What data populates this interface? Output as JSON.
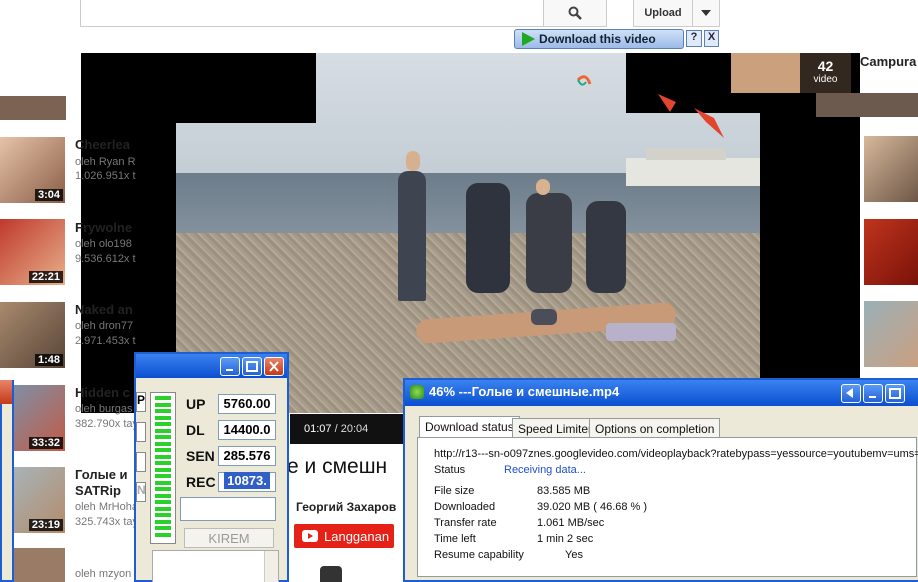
{
  "header": {
    "search_icon": "search-icon",
    "upload_label": "Upload",
    "upload_menu_icon": "chevron-down-icon",
    "download_button": "Download this video",
    "help_label": "?",
    "close_label": "X"
  },
  "player": {
    "time_current": "01:07",
    "time_sep": " / ",
    "time_total": "20:04",
    "title": "е и смешн",
    "channel": "Георгий Захаров",
    "subscribe_label": "Langganan"
  },
  "left_list": [
    {
      "title": "Cheerlea",
      "by": "oleh Ryan R",
      "views": "1.026.951x t",
      "duration": "3:04"
    },
    {
      "title": "Frywolne",
      "by": "oleh olo198",
      "views": "9.536.612x t",
      "duration": "22:21"
    },
    {
      "title": "Naked an",
      "by": "oleh dron77",
      "views": "2.971.453x t",
      "duration": "1:48"
    },
    {
      "title": "Hidden c",
      "by": "oleh burgas",
      "views": "382.790x tay",
      "duration": "33:32"
    },
    {
      "title": "Голые и",
      "title2": "SATRip",
      "by": "oleh MrHoha",
      "views": "325.743x tay",
      "duration": "23:19"
    },
    {
      "title": "",
      "by": "oleh mzyon",
      "views": "",
      "duration": ""
    }
  ],
  "right_list": {
    "playlist_count": "42",
    "playlist_unit": "video",
    "playlist_title": "Campura"
  },
  "meter_window": {
    "labels": {
      "up": "UP",
      "dl": "DL",
      "sen": "SEN",
      "rec": "REC"
    },
    "values": {
      "up": "5760.00",
      "dl": "14400.0",
      "sen": "285.576",
      "rec": "10873."
    },
    "kirem_label": "KIREM",
    "side_label_p": "P",
    "side_label_n": "N",
    "meter_level_fraction": 1.0
  },
  "download_window": {
    "title": "46% ---Голые и смешные.mp4",
    "tabs": [
      "Download status",
      "Speed Limiter",
      "Options on completion"
    ],
    "url": "http://r13---sn-o097znes.googlevideo.com/videoplayback?ratebypass=yessource=youtubemv=ums=",
    "status_label": "Status",
    "status_value": "Receiving data...",
    "rows": [
      {
        "label": "File size",
        "value": "83.585  MB"
      },
      {
        "label": "Downloaded",
        "value": "39.020  MB  ( 46.68 % )"
      },
      {
        "label": "Transfer rate",
        "value": "1.061  MB/sec"
      },
      {
        "label": "Time left",
        "value": "1 min 2 sec"
      },
      {
        "label": "Resume capability",
        "value": "Yes"
      }
    ],
    "progress_percent": 46.68,
    "status_color": "#2050c8"
  }
}
